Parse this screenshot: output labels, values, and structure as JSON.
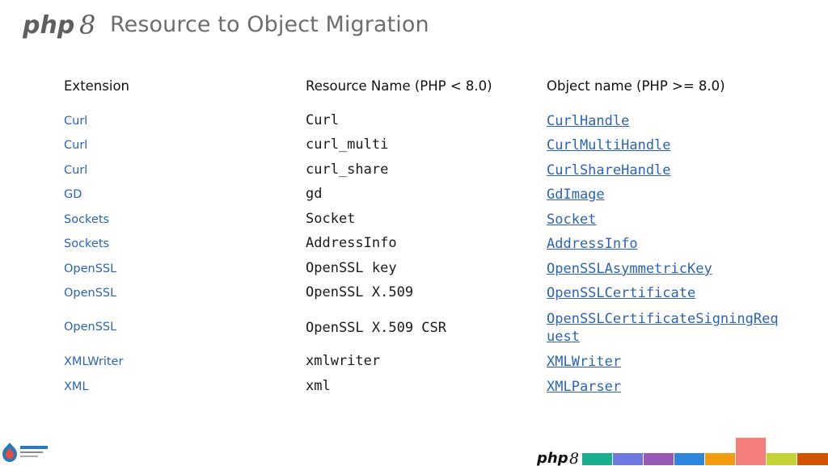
{
  "header": {
    "logo_text": "php8",
    "title": "Resource to Object Migration"
  },
  "columns": {
    "extension": "Extension",
    "resource": "Resource Name (PHP < 8.0)",
    "object": "Object name (PHP >= 8.0)"
  },
  "rows": [
    {
      "extension": "Curl",
      "resource": "Curl",
      "object": "CurlHandle"
    },
    {
      "extension": "Curl",
      "resource": "curl_multi",
      "object": "CurlMultiHandle"
    },
    {
      "extension": "Curl",
      "resource": "curl_share",
      "object": "CurlShareHandle"
    },
    {
      "extension": "GD",
      "resource": "gd",
      "object": "GdImage"
    },
    {
      "extension": "Sockets",
      "resource": "Socket",
      "object": "Socket"
    },
    {
      "extension": "Sockets",
      "resource": "AddressInfo",
      "object": "AddressInfo"
    },
    {
      "extension": "OpenSSL",
      "resource": "OpenSSL key",
      "object": "OpenSSLAsymmetricKey"
    },
    {
      "extension": "OpenSSL",
      "resource": "OpenSSL X.509",
      "object": "OpenSSLCertificate"
    },
    {
      "extension": "OpenSSL",
      "resource": "OpenSSL X.509 CSR",
      "object": "OpenSSLCertificateSigningRequest"
    },
    {
      "extension": "XMLWriter",
      "resource": "xmlwriter",
      "object": "XMLWriter"
    },
    {
      "extension": "XML",
      "resource": "xml",
      "object": "XMLParser"
    }
  ],
  "footer": {
    "drupal_logo_text": "DrupalCon",
    "php_logo_text": "php8"
  },
  "colors": {
    "link": "#2a63b8",
    "bars": [
      "#1aaf8f",
      "#6f78e0",
      "#9b59b6",
      "#2e86de",
      "#f39c12",
      "#f47f7a",
      "#c5d235",
      "#d35400"
    ]
  }
}
